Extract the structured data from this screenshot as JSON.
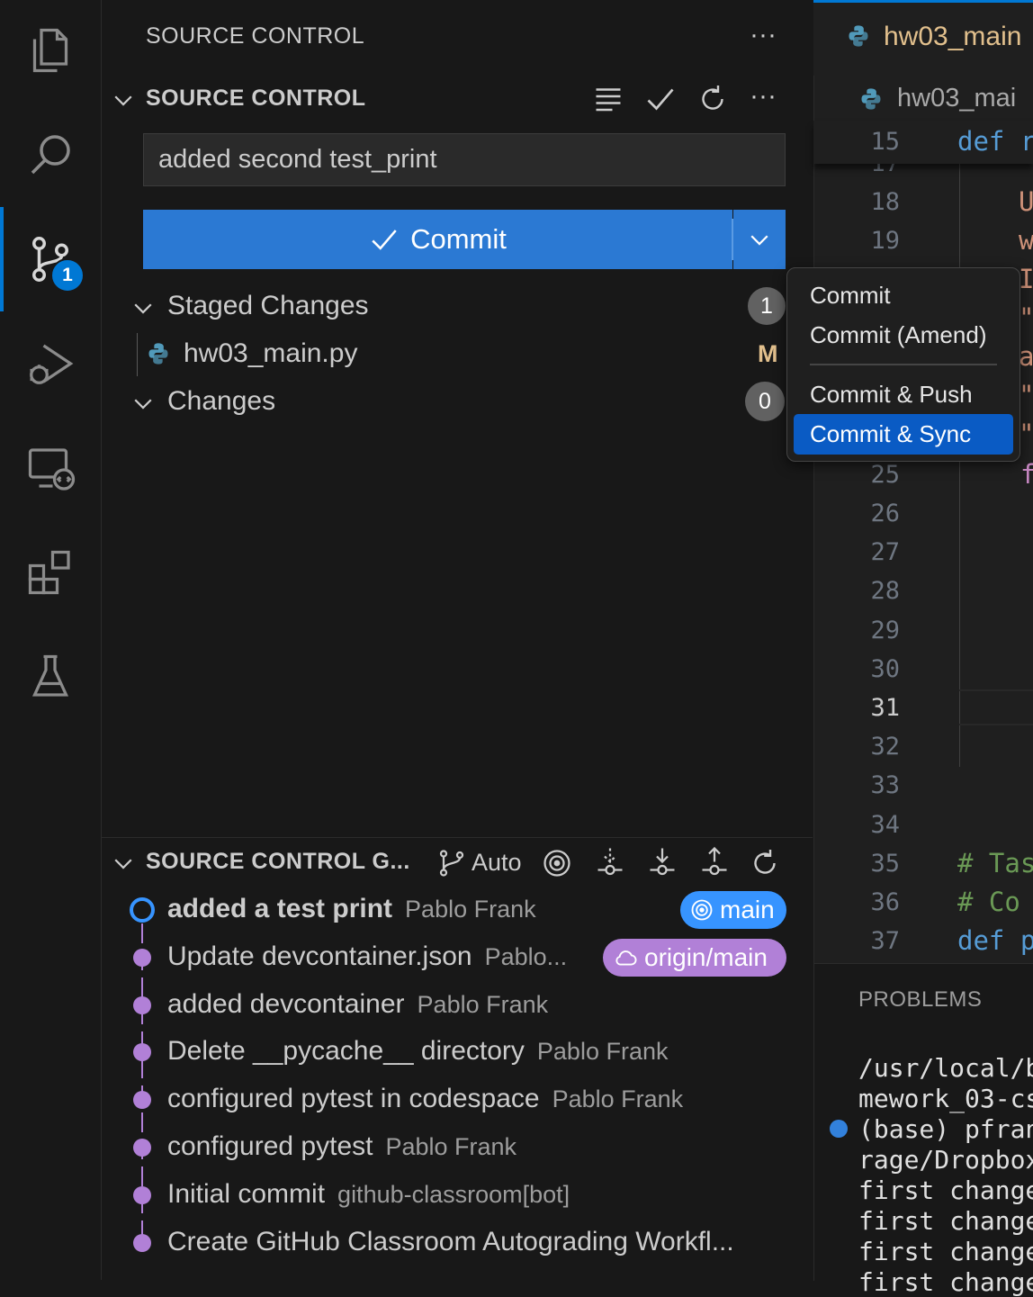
{
  "activity_bar": {
    "icons": [
      "files-icon",
      "search-icon",
      "source-control-icon",
      "run-debug-icon",
      "remote-explorer-icon",
      "extensions-icon",
      "testing-icon"
    ],
    "scm_badge": "1",
    "accent": "#0078d4"
  },
  "sidebar": {
    "title": "SOURCE CONTROL",
    "more": "···",
    "section_header": "SOURCE CONTROL",
    "message_value": "added second test_print",
    "commit_label": "Commit",
    "staged_label": "Staged Changes",
    "staged_count": "1",
    "staged_file": "hw03_main.py",
    "staged_file_status": "M",
    "changes_label": "Changes",
    "changes_count": "0"
  },
  "graph": {
    "header": "SOURCE CONTROL G...",
    "auto_label": "Auto",
    "commits": [
      {
        "title": "added a test print",
        "author": "Pablo Frank"
      },
      {
        "title": "Update devcontainer.json",
        "author": "Pablo..."
      },
      {
        "title": "added devcontainer",
        "author": "Pablo Frank"
      },
      {
        "title": "Delete __pycache__ directory",
        "author": "Pablo Frank"
      },
      {
        "title": "configured pytest in codespace",
        "author": "Pablo Frank"
      },
      {
        "title": "configured pytest",
        "author": "Pablo Frank"
      },
      {
        "title": "Initial commit",
        "author": "github-classroom[bot]"
      },
      {
        "title": "Create GitHub Classroom Autograding Workfl...",
        "author": ""
      }
    ],
    "branch_local": "main",
    "branch_remote": "origin/main",
    "colors": {
      "graph": "#b180d7",
      "head": "#3794ff",
      "remote_pill": "#b180d7"
    }
  },
  "menu": {
    "items": [
      "Commit",
      "Commit (Amend)",
      "Commit & Push",
      "Commit & Sync"
    ],
    "selected": "Commit & Sync"
  },
  "editor": {
    "tab_label": "hw03_main",
    "breadcrumb": "hw03_mai",
    "sticky_line": "15",
    "sticky_code": "def r",
    "lines": [
      {
        "n": "17",
        "code": ""
      },
      {
        "n": "18",
        "code": "U"
      },
      {
        "n": "19",
        "code": "w"
      },
      {
        "n": "25",
        "code": "f"
      },
      {
        "n": "26",
        "code": ""
      },
      {
        "n": "27",
        "code": ""
      },
      {
        "n": "28",
        "code": ""
      },
      {
        "n": "29",
        "code": ""
      },
      {
        "n": "30",
        "code": ""
      },
      {
        "n": "31",
        "code": ""
      },
      {
        "n": "32",
        "code": ""
      },
      {
        "n": "33",
        "code": ""
      },
      {
        "n": "34",
        "code": ""
      },
      {
        "n": "35",
        "code": "# Tas"
      },
      {
        "n": "36",
        "code": "#  Co"
      },
      {
        "n": "37",
        "code": "def p"
      }
    ],
    "hidden_chars": [
      "I",
      "\"",
      "a",
      "\"",
      "\""
    ]
  },
  "panel": {
    "title": "PROBLEMS",
    "terminal_lines": [
      "/usr/local/b",
      "mework_03-cs",
      "(base) pfran",
      "rage/Dropbox",
      "first change",
      "first change",
      "first change",
      "first change"
    ]
  }
}
